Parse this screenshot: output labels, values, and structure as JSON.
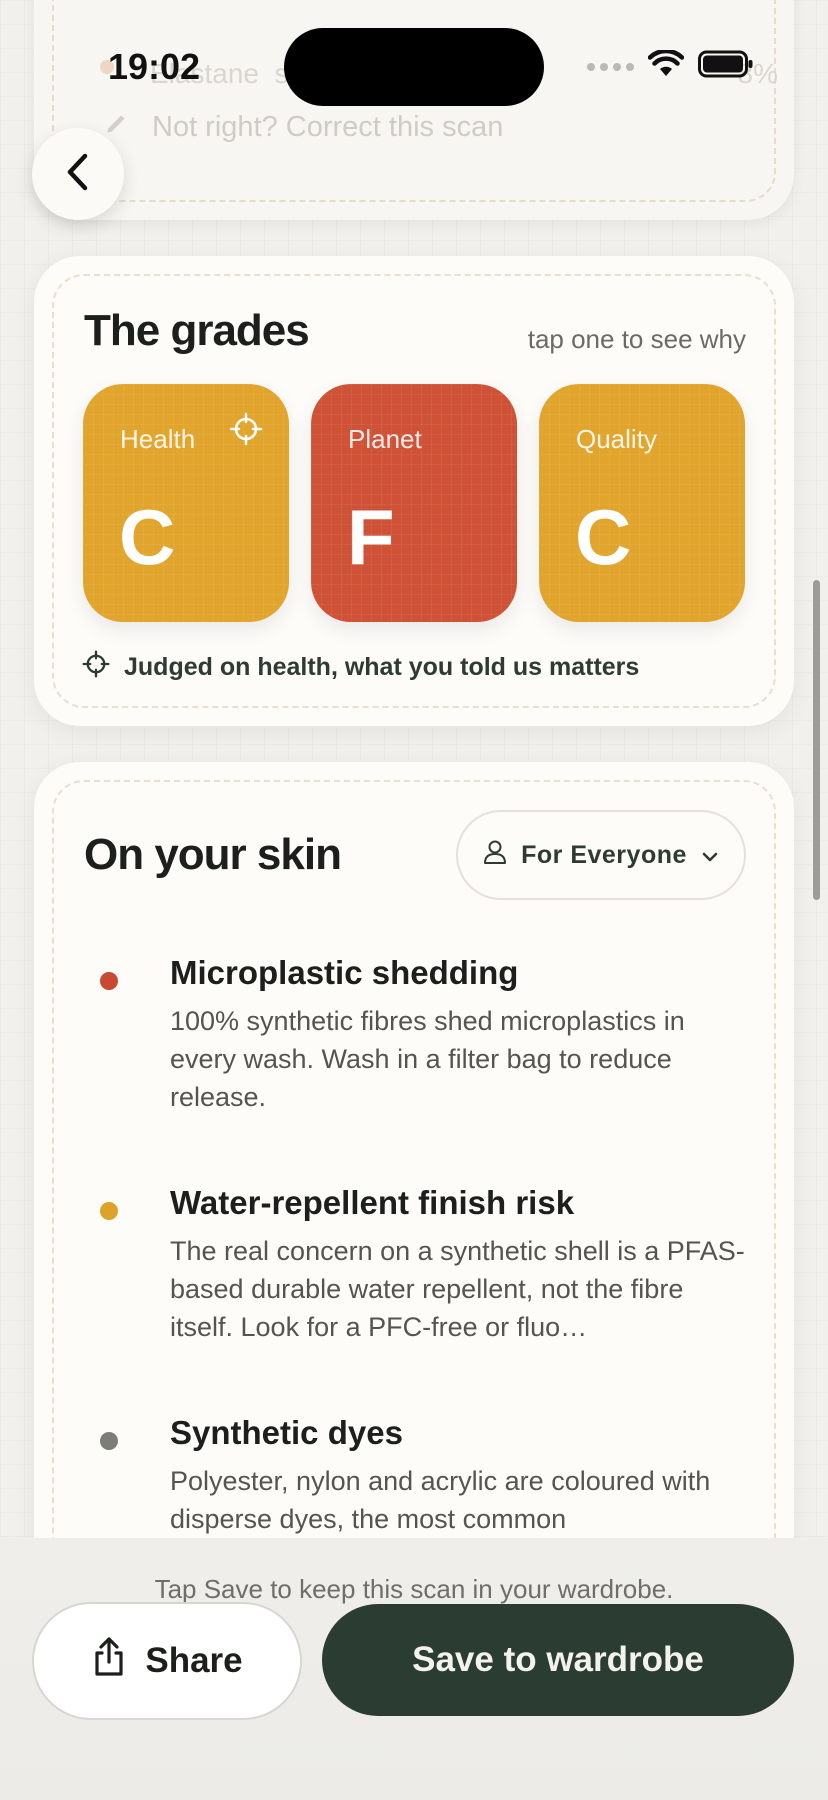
{
  "status_bar": {
    "time": "19:02"
  },
  "previous_section": {
    "faded_fibre": "Elastane",
    "faded_type": "synthetic",
    "faded_percent": "8%",
    "correct_link": "Not right? Correct this scan"
  },
  "grades": {
    "title": "The grades",
    "hint": "tap one to see why",
    "tiles": [
      {
        "label": "Health",
        "grade": "C",
        "color": "#e1a42d",
        "focused": true
      },
      {
        "label": "Planet",
        "grade": "F",
        "color": "#cf5237"
      },
      {
        "label": "Quality",
        "grade": "C",
        "color": "#e1a42d"
      }
    ],
    "judged_note": "Judged on health, what you told us matters"
  },
  "skin": {
    "title": "On your skin",
    "audience_label": "For Everyone",
    "items": [
      {
        "title": "Microplastic shedding",
        "body": "100% synthetic fibres shed microplastics in every wash. Wash in a filter bag to reduce release.",
        "dot_color": "#c94a33"
      },
      {
        "title": "Water-repellent finish risk",
        "body": "The real concern on a synthetic shell is a PFAS-based durable water repellent, not the fibre itself. Look for a PFC-free or fluo…",
        "dot_color": "#dca229"
      },
      {
        "title": "Synthetic dyes",
        "body": "Polyester, nylon and acrylic are coloured with disperse dyes, the most common",
        "dot_color": "#7d7d78"
      }
    ]
  },
  "bottom": {
    "hint": "Tap Save to keep this scan in your wardrobe.",
    "share_label": "Share",
    "save_label": "Save to wardrobe"
  }
}
